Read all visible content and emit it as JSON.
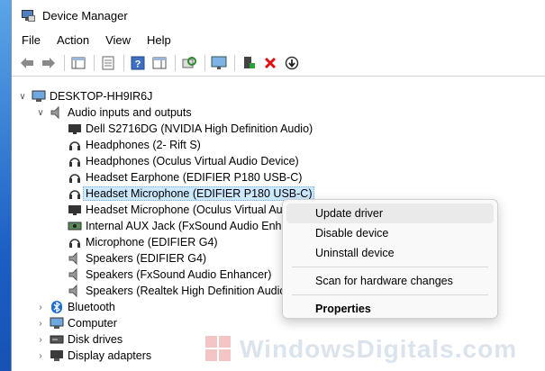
{
  "window": {
    "title": "Device Manager"
  },
  "menu": [
    "File",
    "Action",
    "View",
    "Help"
  ],
  "toolbar_icons": [
    "back-icon",
    "forward-icon",
    "show-hide-tree-icon",
    "properties-icon",
    "help-icon",
    "action-pane-icon",
    "scan-hardware-icon",
    "display-icon",
    "enable-device-icon",
    "uninstall-icon",
    "update-driver-icon"
  ],
  "tree": {
    "root": "DESKTOP-HH9IR6J",
    "audio_category": "Audio inputs and outputs",
    "audio_items": [
      "Dell S2716DG (NVIDIA High Definition Audio)",
      "Headphones (2- Rift S)",
      "Headphones (Oculus Virtual Audio Device)",
      "Headset Earphone (EDIFIER P180 USB-C)",
      "Headset Microphone (EDIFIER P180 USB-C)",
      "Headset Microphone (Oculus Virtual Audio",
      "Internal AUX Jack (FxSound Audio Enhan",
      "Microphone (EDIFIER G4)",
      "Speakers (EDIFIER G4)",
      "Speakers (FxSound Audio Enhancer)",
      "Speakers (Realtek High Definition Audio)"
    ],
    "other_categories": [
      "Bluetooth",
      "Computer",
      "Disk drives",
      "Display adapters"
    ]
  },
  "context_menu": {
    "update_driver": "Update driver",
    "disable_device": "Disable device",
    "uninstall_device": "Uninstall device",
    "scan": "Scan for hardware changes",
    "properties": "Properties"
  },
  "watermark": "WindowsDigitals.com",
  "colors": {
    "selection": "#cce8ff",
    "desktop": "#1f5fb8"
  }
}
